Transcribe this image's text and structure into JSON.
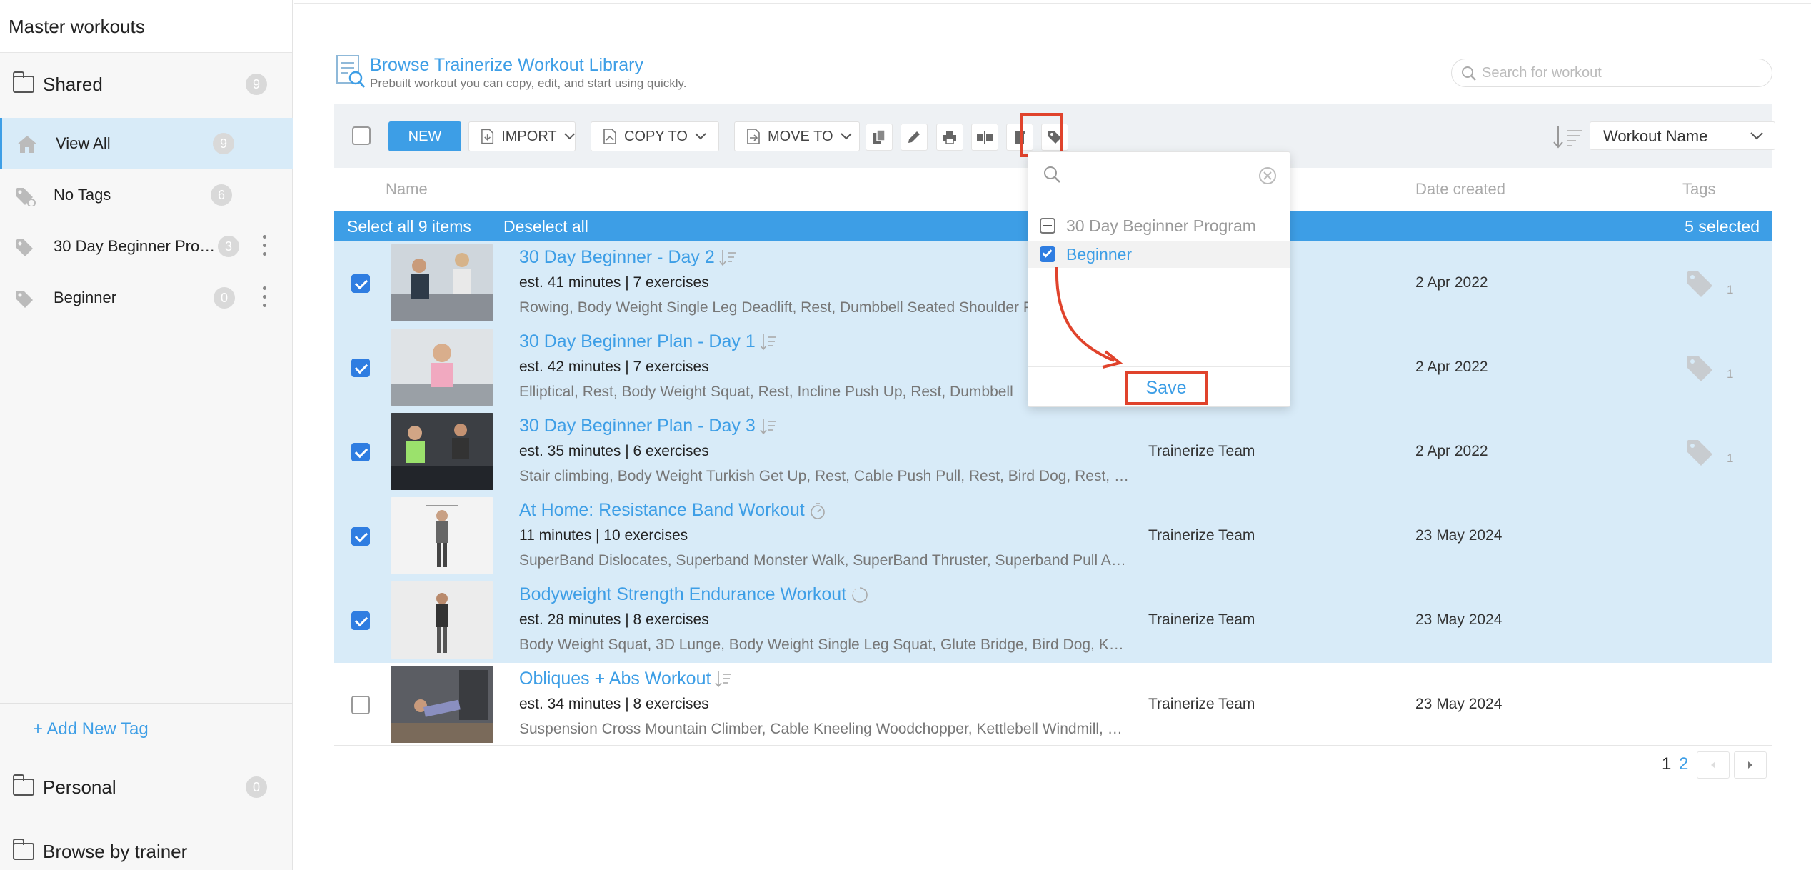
{
  "sidebar": {
    "title": "Master workouts",
    "shared": {
      "label": "Shared",
      "count": "9"
    },
    "items": [
      {
        "label": "View All",
        "count": "9",
        "icon": "home-icon"
      },
      {
        "label": "No Tags",
        "count": "6",
        "icon": "tag-off-icon"
      },
      {
        "label": "30 Day Beginner Pro…",
        "count": "3",
        "icon": "tag-icon"
      },
      {
        "label": "Beginner",
        "count": "0",
        "icon": "tag-icon"
      }
    ],
    "add_tag": "+ Add New Tag",
    "personal": {
      "label": "Personal",
      "count": "0"
    },
    "browse_by_trainer": "Browse by trainer"
  },
  "header": {
    "title": "Browse Trainerize Workout Library",
    "subtitle": "Prebuilt workout you can copy, edit, and start using quickly.",
    "search_placeholder": "Search for workout"
  },
  "toolbar": {
    "new_label": "NEW",
    "import_label": "IMPORT",
    "copy_to_label": "COPY TO",
    "move_to_label": "MOVE TO",
    "sort_label": "Workout Name"
  },
  "columns": {
    "name": "Name",
    "date_created": "Date created",
    "tags": "Tags"
  },
  "selection_bar": {
    "select_all": "Select all 9 items",
    "deselect_all": "Deselect all",
    "selected": "5 selected"
  },
  "rows": [
    {
      "title": "30 Day Beginner - Day 2",
      "meta": "est. 41 minutes | 7 exercises",
      "exercises": "Rowing, Body Weight Single Leg Deadlift, Rest, Dumbbell Seated Shoulder Press, Rest",
      "creator": "",
      "date": "2 Apr 2022",
      "tag_count": "1",
      "checked": true,
      "title_icon": "sort-list-icon"
    },
    {
      "title": "30 Day Beginner Plan - Day 1",
      "meta": "est. 42 minutes | 7 exercises",
      "exercises": "Elliptical, Rest, Body Weight Squat, Rest, Incline Push Up, Rest, Dumbbell",
      "creator": "",
      "date": "2 Apr 2022",
      "tag_count": "1",
      "checked": true,
      "title_icon": "sort-list-icon"
    },
    {
      "title": "30 Day Beginner Plan - Day 3",
      "meta": "est. 35 minutes | 6 exercises",
      "exercises": "Stair climbing, Body Weight Turkish Get Up, Rest, Cable Push Pull, Rest, Bird Dog, Rest, …",
      "creator": "Trainerize Team",
      "date": "2 Apr 2022",
      "tag_count": "1",
      "checked": true,
      "title_icon": "sort-list-icon"
    },
    {
      "title": "At Home: Resistance Band Workout",
      "meta": "11 minutes | 10 exercises",
      "exercises": "SuperBand Dislocates, Superband Monster Walk, SuperBand Thruster, Superband Pull A…",
      "creator": "Trainerize Team",
      "date": "23 May 2024",
      "tag_count": "",
      "checked": true,
      "title_icon": "timer-icon"
    },
    {
      "title": "Bodyweight Strength Endurance Workout",
      "meta": "est. 28 minutes | 8 exercises",
      "exercises": "Body Weight Squat, 3D Lunge, Body Weight Single Leg Squat, Glute Bridge, Bird Dog, K…",
      "creator": "Trainerize Team",
      "date": "23 May 2024",
      "tag_count": "",
      "checked": true,
      "title_icon": "circuit-icon"
    },
    {
      "title": "Obliques + Abs Workout",
      "meta": "est. 34 minutes | 8 exercises",
      "exercises": "Suspension Cross Mountain Climber, Cable Kneeling Woodchopper, Kettlebell Windmill, …",
      "creator": "Trainerize Team",
      "date": "23 May 2024",
      "tag_count": "",
      "checked": false,
      "title_icon": "sort-list-icon"
    }
  ],
  "tag_popup": {
    "search_value": "",
    "options": [
      {
        "label": "30 Day Beginner Program",
        "state": "indeterminate"
      },
      {
        "label": "Beginner",
        "state": "checked"
      }
    ],
    "save_label": "Save"
  },
  "pagination": {
    "current": "1",
    "next": "2"
  },
  "colors": {
    "accent": "#3d9ee6",
    "selected_row": "#d8ebf8",
    "highlight": "#e0432c"
  }
}
